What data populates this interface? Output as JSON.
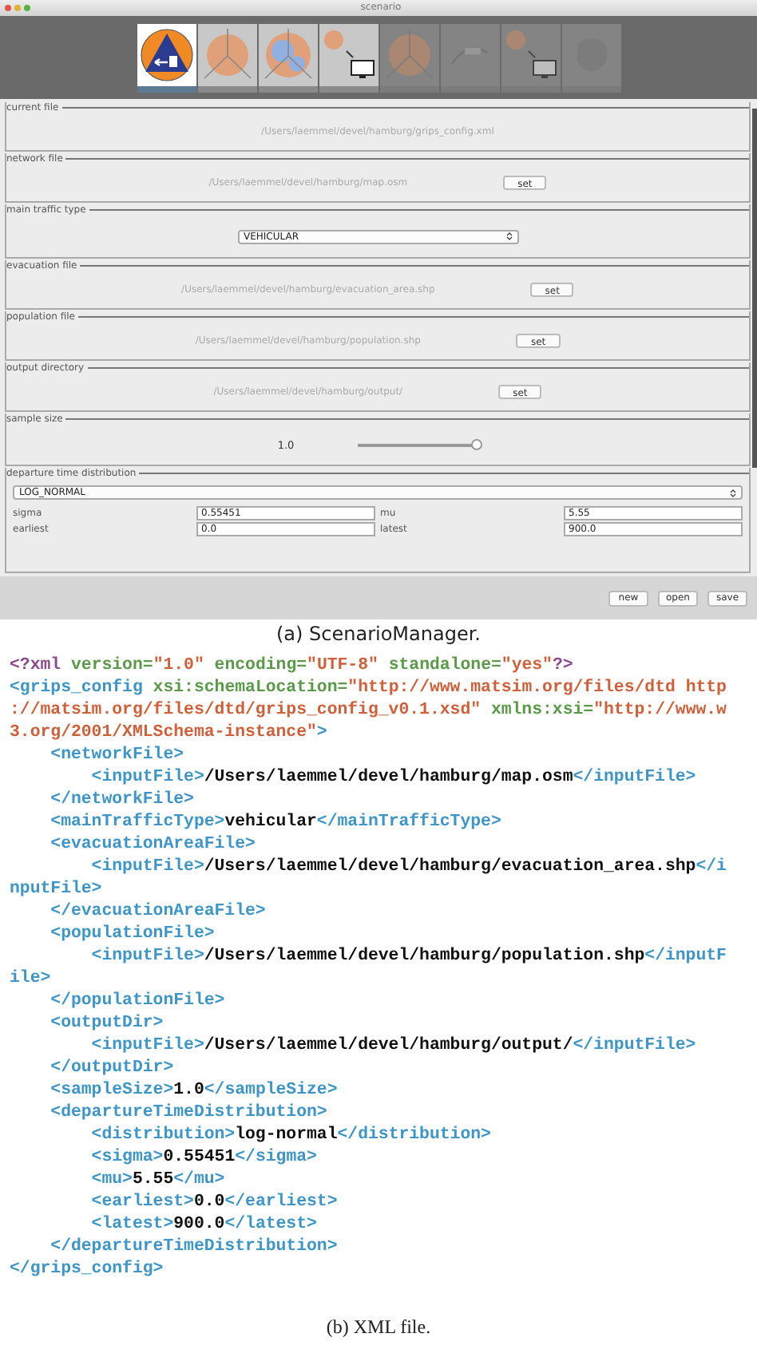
{
  "window": {
    "title": "scenario"
  },
  "tools": [
    {
      "kind": "evacuation",
      "selected": true,
      "disabled": false
    },
    {
      "kind": "area",
      "selected": false,
      "disabled": false
    },
    {
      "kind": "population",
      "selected": false,
      "disabled": false
    },
    {
      "kind": "export",
      "selected": false,
      "disabled": false
    },
    {
      "kind": "area",
      "selected": false,
      "disabled": true
    },
    {
      "kind": "route",
      "selected": false,
      "disabled": true
    },
    {
      "kind": "export",
      "selected": false,
      "disabled": true
    },
    {
      "kind": "blob",
      "selected": false,
      "disabled": true
    }
  ],
  "panels": [
    {
      "kind": "file",
      "label": "current file",
      "path": "/Users/laemmel/devel/hamburg/grips_config.xml"
    },
    {
      "kind": "file",
      "label": "network file",
      "path": "/Users/laemmel/devel/hamburg/map.osm",
      "button": "set"
    },
    {
      "kind": "select",
      "label": "main traffic type",
      "value": "VEHICULAR"
    },
    {
      "kind": "file",
      "label": "evacuation file",
      "path": "/Users/laemmel/devel/hamburg/evacuation_area.shp",
      "button": "set"
    },
    {
      "kind": "file",
      "label": "population file",
      "path": "/Users/laemmel/devel/hamburg/population.shp",
      "button": "set"
    },
    {
      "kind": "file",
      "label": "output directory",
      "path": "/Users/laemmel/devel/hamburg/output/",
      "button": "set"
    },
    {
      "kind": "slider",
      "label": "sample size",
      "reading": "1.0",
      "level": 1
    },
    {
      "kind": "distribution",
      "label": "departure time distribution",
      "value": "LOG_NORMAL",
      "fields": [
        {
          "label": "sigma",
          "value": "0.55451"
        },
        {
          "label": "mu",
          "value": "5.55"
        },
        {
          "label": "earliest",
          "value": "0.0"
        },
        {
          "label": "latest",
          "value": "900.0"
        }
      ]
    }
  ],
  "buttons": [
    "new",
    "open",
    "save"
  ],
  "caption_a": "(a) ScenarioManager.",
  "code": [
    [
      {
        "kind": "decl",
        "text": "<?xml"
      },
      {
        "kind": "attr",
        "text": " version="
      },
      {
        "kind": "value",
        "text": "\"1.0\""
      },
      {
        "kind": "attr",
        "text": " encoding="
      },
      {
        "kind": "value",
        "text": "\"UTF-8\""
      },
      {
        "kind": "attr",
        "text": " standalone="
      },
      {
        "kind": "value",
        "text": "\"yes\""
      },
      {
        "kind": "decl",
        "text": "?>"
      }
    ],
    [
      {
        "kind": "tag",
        "text": "<grips_config"
      },
      {
        "kind": "attr",
        "text": " xsi:schemaLocation="
      },
      {
        "kind": "value",
        "text": "\"http://www.matsim.org/files/dtd http"
      }
    ],
    [
      {
        "kind": "value",
        "text": "://matsim.org/files/dtd/grips_config_v0.1.xsd\""
      },
      {
        "kind": "attr",
        "text": " xmlns:xsi="
      },
      {
        "kind": "value",
        "text": "\"http://www.w"
      }
    ],
    [
      {
        "kind": "value",
        "text": "3.org/2001/XMLSchema-instance\""
      },
      {
        "kind": "tag",
        "text": ">"
      }
    ],
    [
      {
        "kind": "tag",
        "text": "    <networkFile>"
      }
    ],
    [
      {
        "kind": "tag",
        "text": "        <inputFile>"
      },
      {
        "kind": "text",
        "text": "/Users/laemmel/devel/hamburg/map.osm"
      },
      {
        "kind": "tag",
        "text": "</inputFile>"
      }
    ],
    [
      {
        "kind": "tag",
        "text": "    </networkFile>"
      }
    ],
    [
      {
        "kind": "tag",
        "text": "    <mainTrafficType>"
      },
      {
        "kind": "text",
        "text": "vehicular"
      },
      {
        "kind": "tag",
        "text": "</mainTrafficType>"
      }
    ],
    [
      {
        "kind": "tag",
        "text": "    <evacuationAreaFile>"
      }
    ],
    [
      {
        "kind": "tag",
        "text": "        <inputFile>"
      },
      {
        "kind": "text",
        "text": "/Users/laemmel/devel/hamburg/evacuation_area.shp"
      },
      {
        "kind": "tag",
        "text": "</i"
      }
    ],
    [
      {
        "kind": "tag",
        "text": "nputFile>"
      }
    ],
    [
      {
        "kind": "tag",
        "text": "    </evacuationAreaFile>"
      }
    ],
    [
      {
        "kind": "tag",
        "text": "    <populationFile>"
      }
    ],
    [
      {
        "kind": "tag",
        "text": "        <inputFile>"
      },
      {
        "kind": "text",
        "text": "/Users/laemmel/devel/hamburg/population.shp"
      },
      {
        "kind": "tag",
        "text": "</inputF"
      }
    ],
    [
      {
        "kind": "tag",
        "text": "ile>"
      }
    ],
    [
      {
        "kind": "tag",
        "text": "    </populationFile>"
      }
    ],
    [
      {
        "kind": "tag",
        "text": "    <outputDir>"
      }
    ],
    [
      {
        "kind": "tag",
        "text": "        <inputFile>"
      },
      {
        "kind": "text",
        "text": "/Users/laemmel/devel/hamburg/output/"
      },
      {
        "kind": "tag",
        "text": "</inputFile>"
      }
    ],
    [
      {
        "kind": "tag",
        "text": "    </outputDir>"
      }
    ],
    [
      {
        "kind": "tag",
        "text": "    <sampleSize>"
      },
      {
        "kind": "text",
        "text": "1.0"
      },
      {
        "kind": "tag",
        "text": "</sampleSize>"
      }
    ],
    [
      {
        "kind": "tag",
        "text": "    <departureTimeDistribution>"
      }
    ],
    [
      {
        "kind": "tag",
        "text": "        <distribution>"
      },
      {
        "kind": "text",
        "text": "log-normal"
      },
      {
        "kind": "tag",
        "text": "</distribution>"
      }
    ],
    [
      {
        "kind": "tag",
        "text": "        <sigma>"
      },
      {
        "kind": "text",
        "text": "0.55451"
      },
      {
        "kind": "tag",
        "text": "</sigma>"
      }
    ],
    [
      {
        "kind": "tag",
        "text": "        <mu>"
      },
      {
        "kind": "text",
        "text": "5.55"
      },
      {
        "kind": "tag",
        "text": "</mu>"
      }
    ],
    [
      {
        "kind": "tag",
        "text": "        <earliest>"
      },
      {
        "kind": "text",
        "text": "0.0"
      },
      {
        "kind": "tag",
        "text": "</earliest>"
      }
    ],
    [
      {
        "kind": "tag",
        "text": "        <latest>"
      },
      {
        "kind": "text",
        "text": "900.0"
      },
      {
        "kind": "tag",
        "text": "</latest>"
      }
    ],
    [
      {
        "kind": "tag",
        "text": "    </departureTimeDistribution>"
      }
    ],
    [
      {
        "kind": "tag",
        "text": "</grips_config>"
      }
    ]
  ],
  "caption_b": "(b) XML file."
}
